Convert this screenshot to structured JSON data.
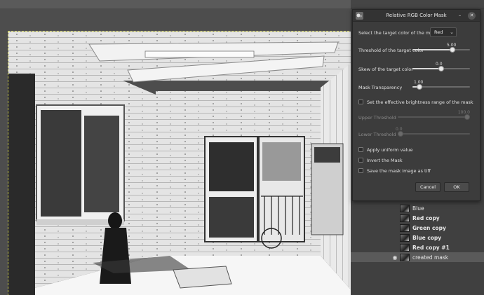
{
  "dialog": {
    "title": "Relative RGB Color Mask",
    "target_color_label": "Select the target color of the mask:",
    "target_color_value": "Red",
    "threshold_label": "Threshold of the target color",
    "threshold_value": "5.00",
    "threshold_fraction": 0.72,
    "skew_label": "Skew of the target color",
    "skew_value": "0.0",
    "skew_fraction": 0.5,
    "transparency_label": "Mask Transparency",
    "transparency_value": "1.00",
    "transparency_fraction": 0.08,
    "brightness_range_label": "Set the effective brightness range of the mask",
    "upper_threshold_label": "Upper Threshold",
    "upper_threshold_value": "100.0",
    "lower_threshold_label": "Lower Threshold",
    "lower_threshold_value": "0.0",
    "apply_uniform_label": "Apply uniform value",
    "invert_label": "Invert the Mask",
    "save_tiff_label": "Save the mask image as tiff",
    "cancel_label": "Cancel",
    "ok_label": "OK"
  },
  "layers": [
    {
      "name": "Blue",
      "bold": false,
      "visible": false,
      "selected": false
    },
    {
      "name": "Red copy",
      "bold": true,
      "visible": false,
      "selected": false
    },
    {
      "name": "Green copy",
      "bold": true,
      "visible": false,
      "selected": false
    },
    {
      "name": "Blue copy",
      "bold": true,
      "visible": false,
      "selected": false
    },
    {
      "name": "Red copy #1",
      "bold": true,
      "visible": false,
      "selected": false
    },
    {
      "name": "created mask",
      "bold": false,
      "visible": true,
      "selected": true
    }
  ],
  "icons": {
    "eye": "eye-icon",
    "minimize": "minimize-icon",
    "close": "close-icon",
    "dropdown": "chevron-down-icon",
    "app": "app-icon"
  }
}
